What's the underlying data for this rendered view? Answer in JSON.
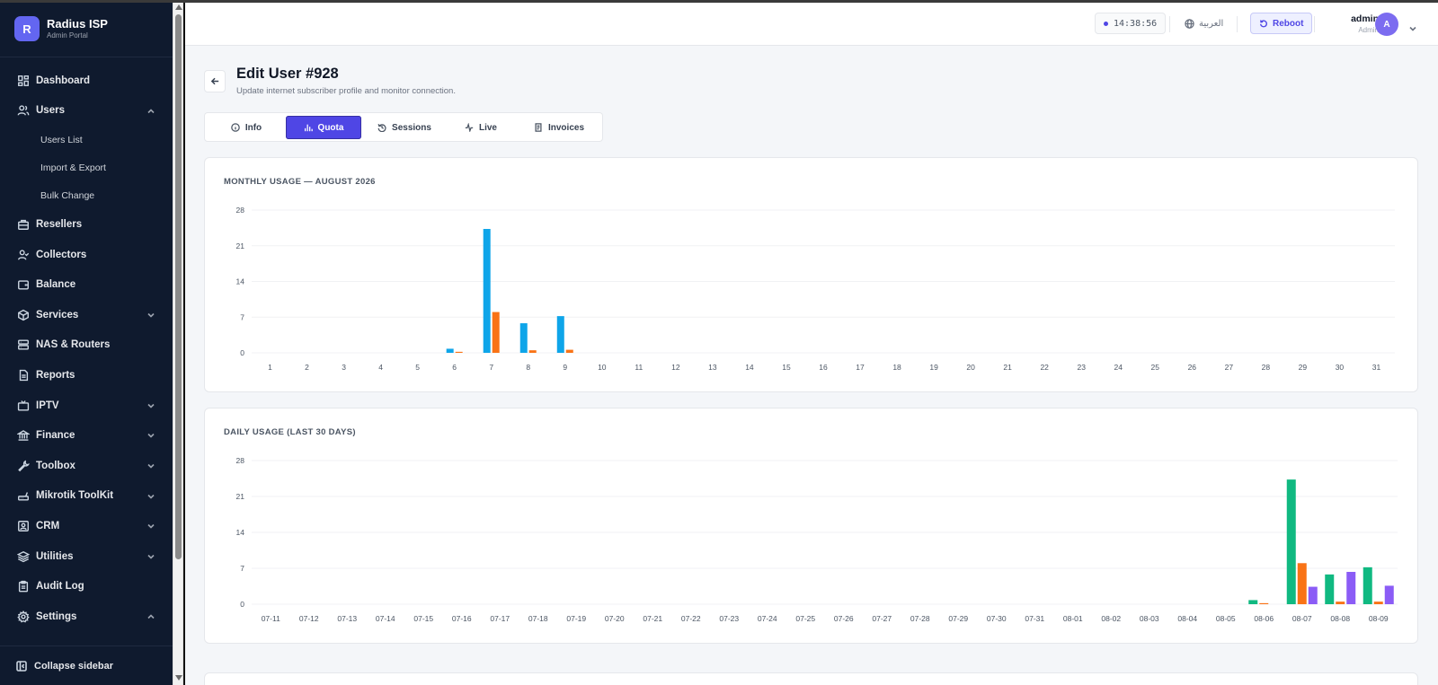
{
  "app": {
    "brand_initial": "R",
    "brand_name": "Radius ISP",
    "brand_subtitle": "Admin Portal"
  },
  "sidebar": {
    "items": [
      {
        "label": "Dashboard",
        "icon": "dashboard-icon"
      },
      {
        "label": "Users",
        "icon": "users-icon",
        "expanded": true,
        "children": [
          "Users List",
          "Import & Export",
          "Bulk Change"
        ]
      },
      {
        "label": "Resellers",
        "icon": "briefcase-icon"
      },
      {
        "label": "Collectors",
        "icon": "user-check-icon"
      },
      {
        "label": "Balance",
        "icon": "wallet-icon"
      },
      {
        "label": "Services",
        "icon": "box-icon",
        "has_chevron": true
      },
      {
        "label": "NAS & Routers",
        "icon": "server-icon"
      },
      {
        "label": "Reports",
        "icon": "report-icon"
      },
      {
        "label": "IPTV",
        "icon": "tv-icon",
        "has_chevron": true
      },
      {
        "label": "Finance",
        "icon": "bank-icon",
        "has_chevron": true
      },
      {
        "label": "Toolbox",
        "icon": "wrench-icon",
        "has_chevron": true
      },
      {
        "label": "Mikrotik ToolKit",
        "icon": "router-icon",
        "has_chevron": true
      },
      {
        "label": "CRM",
        "icon": "contact-icon",
        "has_chevron": true
      },
      {
        "label": "Utilities",
        "icon": "layers-icon",
        "has_chevron": true
      },
      {
        "label": "Audit Log",
        "icon": "clipboard-icon"
      },
      {
        "label": "Settings",
        "icon": "gear-icon",
        "has_chevron": true,
        "expanded": true
      }
    ],
    "collapse_label": "Collapse sidebar"
  },
  "topbar": {
    "time": "14:38:56",
    "language": "العربية",
    "reboot_label": "Reboot",
    "user_name": "admin",
    "user_role": "Admin",
    "avatar_initial": "A"
  },
  "page": {
    "title": "Edit User #928",
    "subtitle": "Update internet subscriber profile and monitor connection."
  },
  "tabs": [
    {
      "label": "Info",
      "icon": "info-icon",
      "active": false
    },
    {
      "label": "Quota",
      "icon": "bar-chart-icon",
      "active": true
    },
    {
      "label": "Sessions",
      "icon": "history-icon",
      "active": false
    },
    {
      "label": "Live",
      "icon": "activity-icon",
      "active": false
    },
    {
      "label": "Invoices",
      "icon": "invoice-icon",
      "active": false
    }
  ],
  "colors": {
    "accent": "#4f46e5",
    "monthly_series_1": "#0ea5e9",
    "monthly_series_2": "#f97316",
    "daily_series_1": "#10b981",
    "daily_series_2": "#f97316",
    "daily_series_3": "#8b5cf6"
  },
  "chart_data": [
    {
      "type": "bar",
      "title": "MONTHLY USAGE — AUGUST 2026",
      "xlabel": "",
      "ylabel": "",
      "ylim": [
        0,
        28
      ],
      "yticks": [
        0,
        7,
        14,
        21,
        28
      ],
      "grid": true,
      "categories": [
        "1",
        "2",
        "3",
        "4",
        "5",
        "6",
        "7",
        "8",
        "9",
        "10",
        "11",
        "12",
        "13",
        "14",
        "15",
        "16",
        "17",
        "18",
        "19",
        "20",
        "21",
        "22",
        "23",
        "24",
        "25",
        "26",
        "27",
        "28",
        "29",
        "30",
        "31"
      ],
      "series": [
        {
          "color": "#0ea5e9",
          "values": [
            0,
            0,
            0,
            0,
            0,
            0.8,
            24.3,
            5.8,
            7.2,
            0,
            0,
            0,
            0,
            0,
            0,
            0,
            0,
            0,
            0,
            0,
            0,
            0,
            0,
            0,
            0,
            0,
            0,
            0,
            0,
            0,
            0
          ]
        },
        {
          "color": "#f97316",
          "values": [
            0,
            0,
            0,
            0,
            0,
            0.2,
            8.0,
            0.5,
            0.6,
            0,
            0,
            0,
            0,
            0,
            0,
            0,
            0,
            0,
            0,
            0,
            0,
            0,
            0,
            0,
            0,
            0,
            0,
            0,
            0,
            0,
            0
          ]
        }
      ]
    },
    {
      "type": "bar",
      "title": "DAILY USAGE (LAST 30 DAYS)",
      "xlabel": "",
      "ylabel": "",
      "ylim": [
        0,
        28
      ],
      "yticks": [
        0,
        7,
        14,
        21,
        28
      ],
      "grid": true,
      "categories": [
        "07-11",
        "07-12",
        "07-13",
        "07-14",
        "07-15",
        "07-16",
        "07-17",
        "07-18",
        "07-19",
        "07-20",
        "07-21",
        "07-22",
        "07-23",
        "07-24",
        "07-25",
        "07-26",
        "07-27",
        "07-28",
        "07-29",
        "07-30",
        "07-31",
        "08-01",
        "08-02",
        "08-03",
        "08-04",
        "08-05",
        "08-06",
        "08-07",
        "08-08",
        "08-09"
      ],
      "series": [
        {
          "color": "#10b981",
          "values": [
            0,
            0,
            0,
            0,
            0,
            0,
            0,
            0,
            0,
            0,
            0,
            0,
            0,
            0,
            0,
            0,
            0,
            0,
            0,
            0,
            0,
            0,
            0,
            0,
            0,
            0,
            0.8,
            24.3,
            5.8,
            7.2
          ]
        },
        {
          "color": "#f97316",
          "values": [
            0,
            0,
            0,
            0,
            0,
            0,
            0,
            0,
            0,
            0,
            0,
            0,
            0,
            0,
            0,
            0,
            0,
            0,
            0,
            0,
            0,
            0,
            0,
            0,
            0,
            0,
            0.2,
            8.0,
            0.5,
            0.5
          ]
        },
        {
          "color": "#8b5cf6",
          "values": [
            0,
            0,
            0,
            0,
            0,
            0,
            0,
            0,
            0,
            0,
            0,
            0,
            0,
            0,
            0,
            0,
            0,
            0,
            0,
            0,
            0,
            0,
            0,
            0,
            0,
            0,
            0,
            3.4,
            6.3,
            3.6
          ]
        }
      ]
    }
  ]
}
